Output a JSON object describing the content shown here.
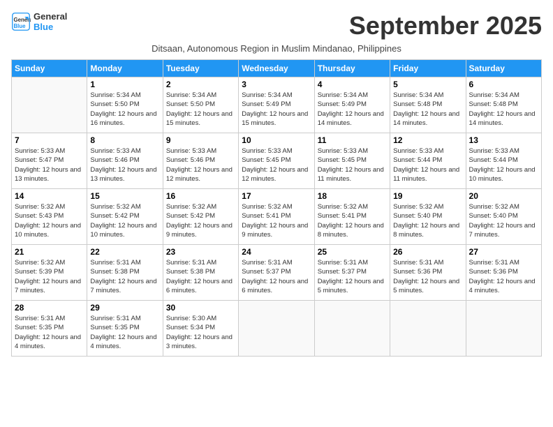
{
  "logo": {
    "line1": "General",
    "line2": "Blue"
  },
  "title": "September 2025",
  "subtitle": "Ditsaan, Autonomous Region in Muslim Mindanao, Philippines",
  "headers": [
    "Sunday",
    "Monday",
    "Tuesday",
    "Wednesday",
    "Thursday",
    "Friday",
    "Saturday"
  ],
  "weeks": [
    [
      {
        "num": "",
        "sunrise": "",
        "sunset": "",
        "daylight": ""
      },
      {
        "num": "1",
        "sunrise": "5:34 AM",
        "sunset": "5:50 PM",
        "daylight": "12 hours and 16 minutes."
      },
      {
        "num": "2",
        "sunrise": "5:34 AM",
        "sunset": "5:50 PM",
        "daylight": "12 hours and 15 minutes."
      },
      {
        "num": "3",
        "sunrise": "5:34 AM",
        "sunset": "5:49 PM",
        "daylight": "12 hours and 15 minutes."
      },
      {
        "num": "4",
        "sunrise": "5:34 AM",
        "sunset": "5:49 PM",
        "daylight": "12 hours and 14 minutes."
      },
      {
        "num": "5",
        "sunrise": "5:34 AM",
        "sunset": "5:48 PM",
        "daylight": "12 hours and 14 minutes."
      },
      {
        "num": "6",
        "sunrise": "5:34 AM",
        "sunset": "5:48 PM",
        "daylight": "12 hours and 14 minutes."
      }
    ],
    [
      {
        "num": "7",
        "sunrise": "5:33 AM",
        "sunset": "5:47 PM",
        "daylight": "12 hours and 13 minutes."
      },
      {
        "num": "8",
        "sunrise": "5:33 AM",
        "sunset": "5:46 PM",
        "daylight": "12 hours and 13 minutes."
      },
      {
        "num": "9",
        "sunrise": "5:33 AM",
        "sunset": "5:46 PM",
        "daylight": "12 hours and 12 minutes."
      },
      {
        "num": "10",
        "sunrise": "5:33 AM",
        "sunset": "5:45 PM",
        "daylight": "12 hours and 12 minutes."
      },
      {
        "num": "11",
        "sunrise": "5:33 AM",
        "sunset": "5:45 PM",
        "daylight": "12 hours and 11 minutes."
      },
      {
        "num": "12",
        "sunrise": "5:33 AM",
        "sunset": "5:44 PM",
        "daylight": "12 hours and 11 minutes."
      },
      {
        "num": "13",
        "sunrise": "5:33 AM",
        "sunset": "5:44 PM",
        "daylight": "12 hours and 10 minutes."
      }
    ],
    [
      {
        "num": "14",
        "sunrise": "5:32 AM",
        "sunset": "5:43 PM",
        "daylight": "12 hours and 10 minutes."
      },
      {
        "num": "15",
        "sunrise": "5:32 AM",
        "sunset": "5:42 PM",
        "daylight": "12 hours and 10 minutes."
      },
      {
        "num": "16",
        "sunrise": "5:32 AM",
        "sunset": "5:42 PM",
        "daylight": "12 hours and 9 minutes."
      },
      {
        "num": "17",
        "sunrise": "5:32 AM",
        "sunset": "5:41 PM",
        "daylight": "12 hours and 9 minutes."
      },
      {
        "num": "18",
        "sunrise": "5:32 AM",
        "sunset": "5:41 PM",
        "daylight": "12 hours and 8 minutes."
      },
      {
        "num": "19",
        "sunrise": "5:32 AM",
        "sunset": "5:40 PM",
        "daylight": "12 hours and 8 minutes."
      },
      {
        "num": "20",
        "sunrise": "5:32 AM",
        "sunset": "5:40 PM",
        "daylight": "12 hours and 7 minutes."
      }
    ],
    [
      {
        "num": "21",
        "sunrise": "5:32 AM",
        "sunset": "5:39 PM",
        "daylight": "12 hours and 7 minutes."
      },
      {
        "num": "22",
        "sunrise": "5:31 AM",
        "sunset": "5:38 PM",
        "daylight": "12 hours and 7 minutes."
      },
      {
        "num": "23",
        "sunrise": "5:31 AM",
        "sunset": "5:38 PM",
        "daylight": "12 hours and 6 minutes."
      },
      {
        "num": "24",
        "sunrise": "5:31 AM",
        "sunset": "5:37 PM",
        "daylight": "12 hours and 6 minutes."
      },
      {
        "num": "25",
        "sunrise": "5:31 AM",
        "sunset": "5:37 PM",
        "daylight": "12 hours and 5 minutes."
      },
      {
        "num": "26",
        "sunrise": "5:31 AM",
        "sunset": "5:36 PM",
        "daylight": "12 hours and 5 minutes."
      },
      {
        "num": "27",
        "sunrise": "5:31 AM",
        "sunset": "5:36 PM",
        "daylight": "12 hours and 4 minutes."
      }
    ],
    [
      {
        "num": "28",
        "sunrise": "5:31 AM",
        "sunset": "5:35 PM",
        "daylight": "12 hours and 4 minutes."
      },
      {
        "num": "29",
        "sunrise": "5:31 AM",
        "sunset": "5:35 PM",
        "daylight": "12 hours and 4 minutes."
      },
      {
        "num": "30",
        "sunrise": "5:30 AM",
        "sunset": "5:34 PM",
        "daylight": "12 hours and 3 minutes."
      },
      {
        "num": "",
        "sunrise": "",
        "sunset": "",
        "daylight": ""
      },
      {
        "num": "",
        "sunrise": "",
        "sunset": "",
        "daylight": ""
      },
      {
        "num": "",
        "sunrise": "",
        "sunset": "",
        "daylight": ""
      },
      {
        "num": "",
        "sunrise": "",
        "sunset": "",
        "daylight": ""
      }
    ]
  ],
  "labels": {
    "sunrise_prefix": "Sunrise: ",
    "sunset_prefix": "Sunset: ",
    "daylight_prefix": "Daylight: "
  }
}
